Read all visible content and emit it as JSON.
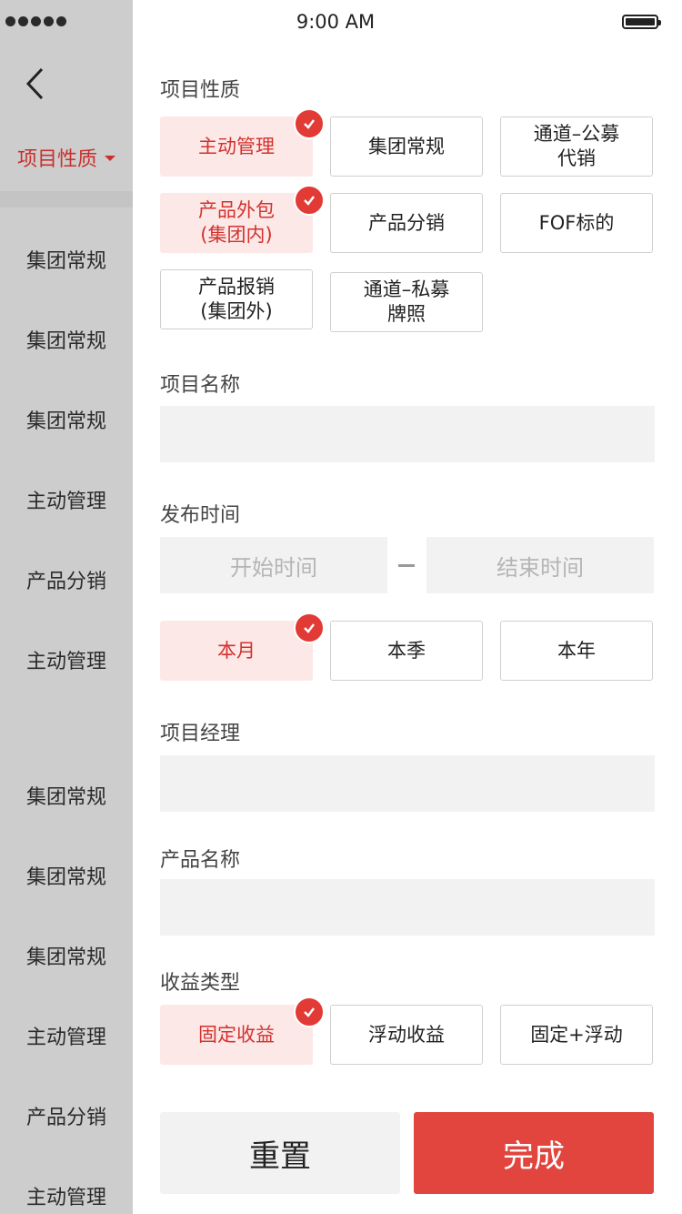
{
  "status_bar": {
    "time": "9:00 AM"
  },
  "left": {
    "active_tab": "项目性质",
    "items": [
      "集团常规",
      "集团常规",
      "集团常规",
      "主动管理",
      "产品分销",
      "主动管理",
      "集团常规",
      "集团常规",
      "集团常规",
      "主动管理",
      "产品分销",
      "主动管理"
    ]
  },
  "sections": {
    "nature": {
      "label": "项目性质",
      "options": [
        {
          "line1": "主动管理",
          "line2": "",
          "selected": true
        },
        {
          "line1": "集团常规",
          "line2": "",
          "selected": false
        },
        {
          "line1": "通道–公募",
          "line2": "代销",
          "selected": false
        },
        {
          "line1": "产品外包",
          "line2": "(集团内)",
          "selected": true
        },
        {
          "line1": "产品分销",
          "line2": "",
          "selected": false
        },
        {
          "line1": "FOF标的",
          "line2": "",
          "selected": false
        },
        {
          "line1": "产品报销",
          "line2": "(集团外)",
          "selected": false
        },
        {
          "line1": "通道–私募",
          "line2": "牌照",
          "selected": false
        }
      ]
    },
    "project_name": {
      "label": "项目名称",
      "value": ""
    },
    "publish_time": {
      "label": "发布时间",
      "start_placeholder": "开始时间",
      "end_placeholder": "结束时间",
      "options": [
        {
          "label": "本月",
          "selected": true
        },
        {
          "label": "本季",
          "selected": false
        },
        {
          "label": "本年",
          "selected": false
        }
      ]
    },
    "manager": {
      "label": "项目经理",
      "value": ""
    },
    "product_name": {
      "label": "产品名称",
      "value": ""
    },
    "income_type": {
      "label": "收益类型",
      "options": [
        {
          "label": "固定收益",
          "selected": true
        },
        {
          "label": "浮动收益",
          "selected": false
        },
        {
          "label": "固定+浮动",
          "selected": false
        }
      ]
    }
  },
  "actions": {
    "reset": "重置",
    "done": "完成"
  },
  "colors": {
    "accent": "#e2453e",
    "selected_bg": "#fde8e8",
    "selected_text": "#d2322d"
  }
}
